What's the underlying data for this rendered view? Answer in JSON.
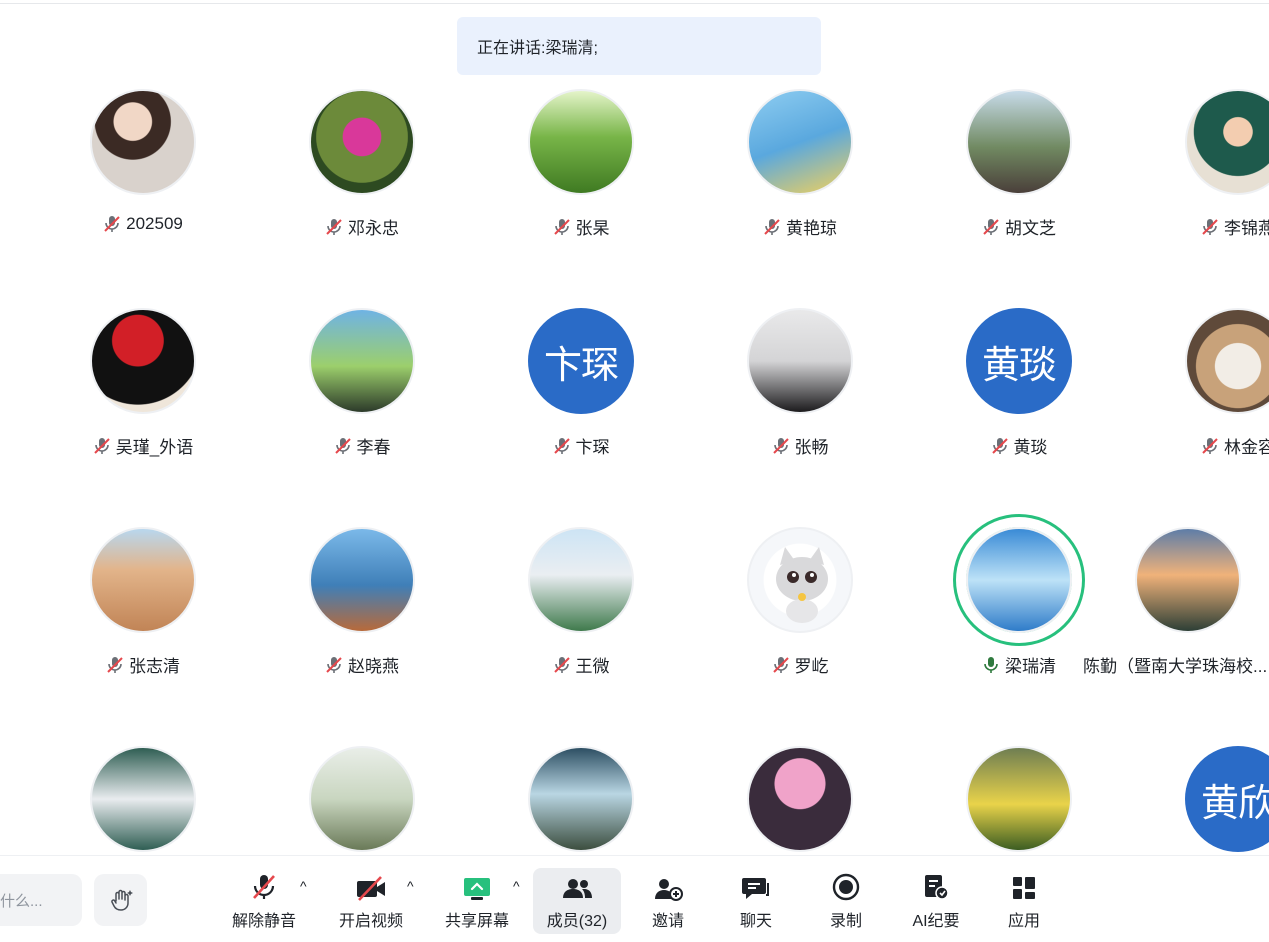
{
  "speaking_banner": {
    "label": "正在讲话: ",
    "speaker": "梁瑞清;"
  },
  "participants": [
    {
      "name": "202509",
      "muted": true,
      "avatar": "photo"
    },
    {
      "name": "邓永忠",
      "muted": true,
      "avatar": "photo"
    },
    {
      "name": "张杲",
      "muted": true,
      "avatar": "photo"
    },
    {
      "name": "黄艳琼",
      "muted": true,
      "avatar": "photo"
    },
    {
      "name": "胡文芝",
      "muted": true,
      "avatar": "photo"
    },
    {
      "name": "李锦燕",
      "muted": true,
      "avatar": "photo"
    },
    {
      "name": "吴瑾_外语",
      "muted": true,
      "avatar": "photo"
    },
    {
      "name": "李春",
      "muted": true,
      "avatar": "photo"
    },
    {
      "name": "卞琛",
      "muted": true,
      "avatar": "text",
      "avatar_text": "卞琛"
    },
    {
      "name": "张畅",
      "muted": true,
      "avatar": "photo"
    },
    {
      "name": "黄琰",
      "muted": true,
      "avatar": "text",
      "avatar_text": "黄琰"
    },
    {
      "name": "林金容",
      "muted": true,
      "avatar": "photo"
    },
    {
      "name": "张志清",
      "muted": true,
      "avatar": "photo"
    },
    {
      "name": "赵晓燕",
      "muted": true,
      "avatar": "photo"
    },
    {
      "name": "王微",
      "muted": true,
      "avatar": "photo"
    },
    {
      "name": "罗屹",
      "muted": true,
      "avatar": "photo"
    },
    {
      "name": "梁瑞清",
      "muted": false,
      "speaking": true,
      "avatar": "photo"
    },
    {
      "name": "陈勤（暨南大学珠海校...",
      "muted": null,
      "avatar": "photo"
    },
    {
      "name": "",
      "avatar": "photo"
    },
    {
      "name": "",
      "avatar": "photo"
    },
    {
      "name": "",
      "avatar": "photo"
    },
    {
      "name": "",
      "avatar": "photo"
    },
    {
      "name": "",
      "avatar": "photo"
    },
    {
      "name": "",
      "avatar": "text",
      "avatar_text": "黄欣"
    }
  ],
  "toolbar": {
    "chat_placeholder": "什么...",
    "unmute": "解除静音",
    "start_video": "开启视频",
    "share_screen": "共享屏幕",
    "members": "成员(32)",
    "invite": "邀请",
    "chat": "聊天",
    "record": "录制",
    "ai_minutes": "AI纪要",
    "apps": "应用",
    "caret": "^"
  },
  "colors": {
    "banner_bg": "#eaf1fd",
    "speaking_ring": "#27c07d",
    "text_avatar_bg": "#2a6bc7",
    "muted_red": "#e5484d",
    "share_green": "#27c07d"
  },
  "icons": [
    "mic-muted-icon",
    "mic-active-icon",
    "raise-hand-icon",
    "video-off-icon",
    "share-screen-icon",
    "members-icon",
    "invite-icon",
    "chat-icon",
    "record-icon",
    "ai-minutes-icon",
    "apps-icon",
    "chevron-up-icon"
  ]
}
